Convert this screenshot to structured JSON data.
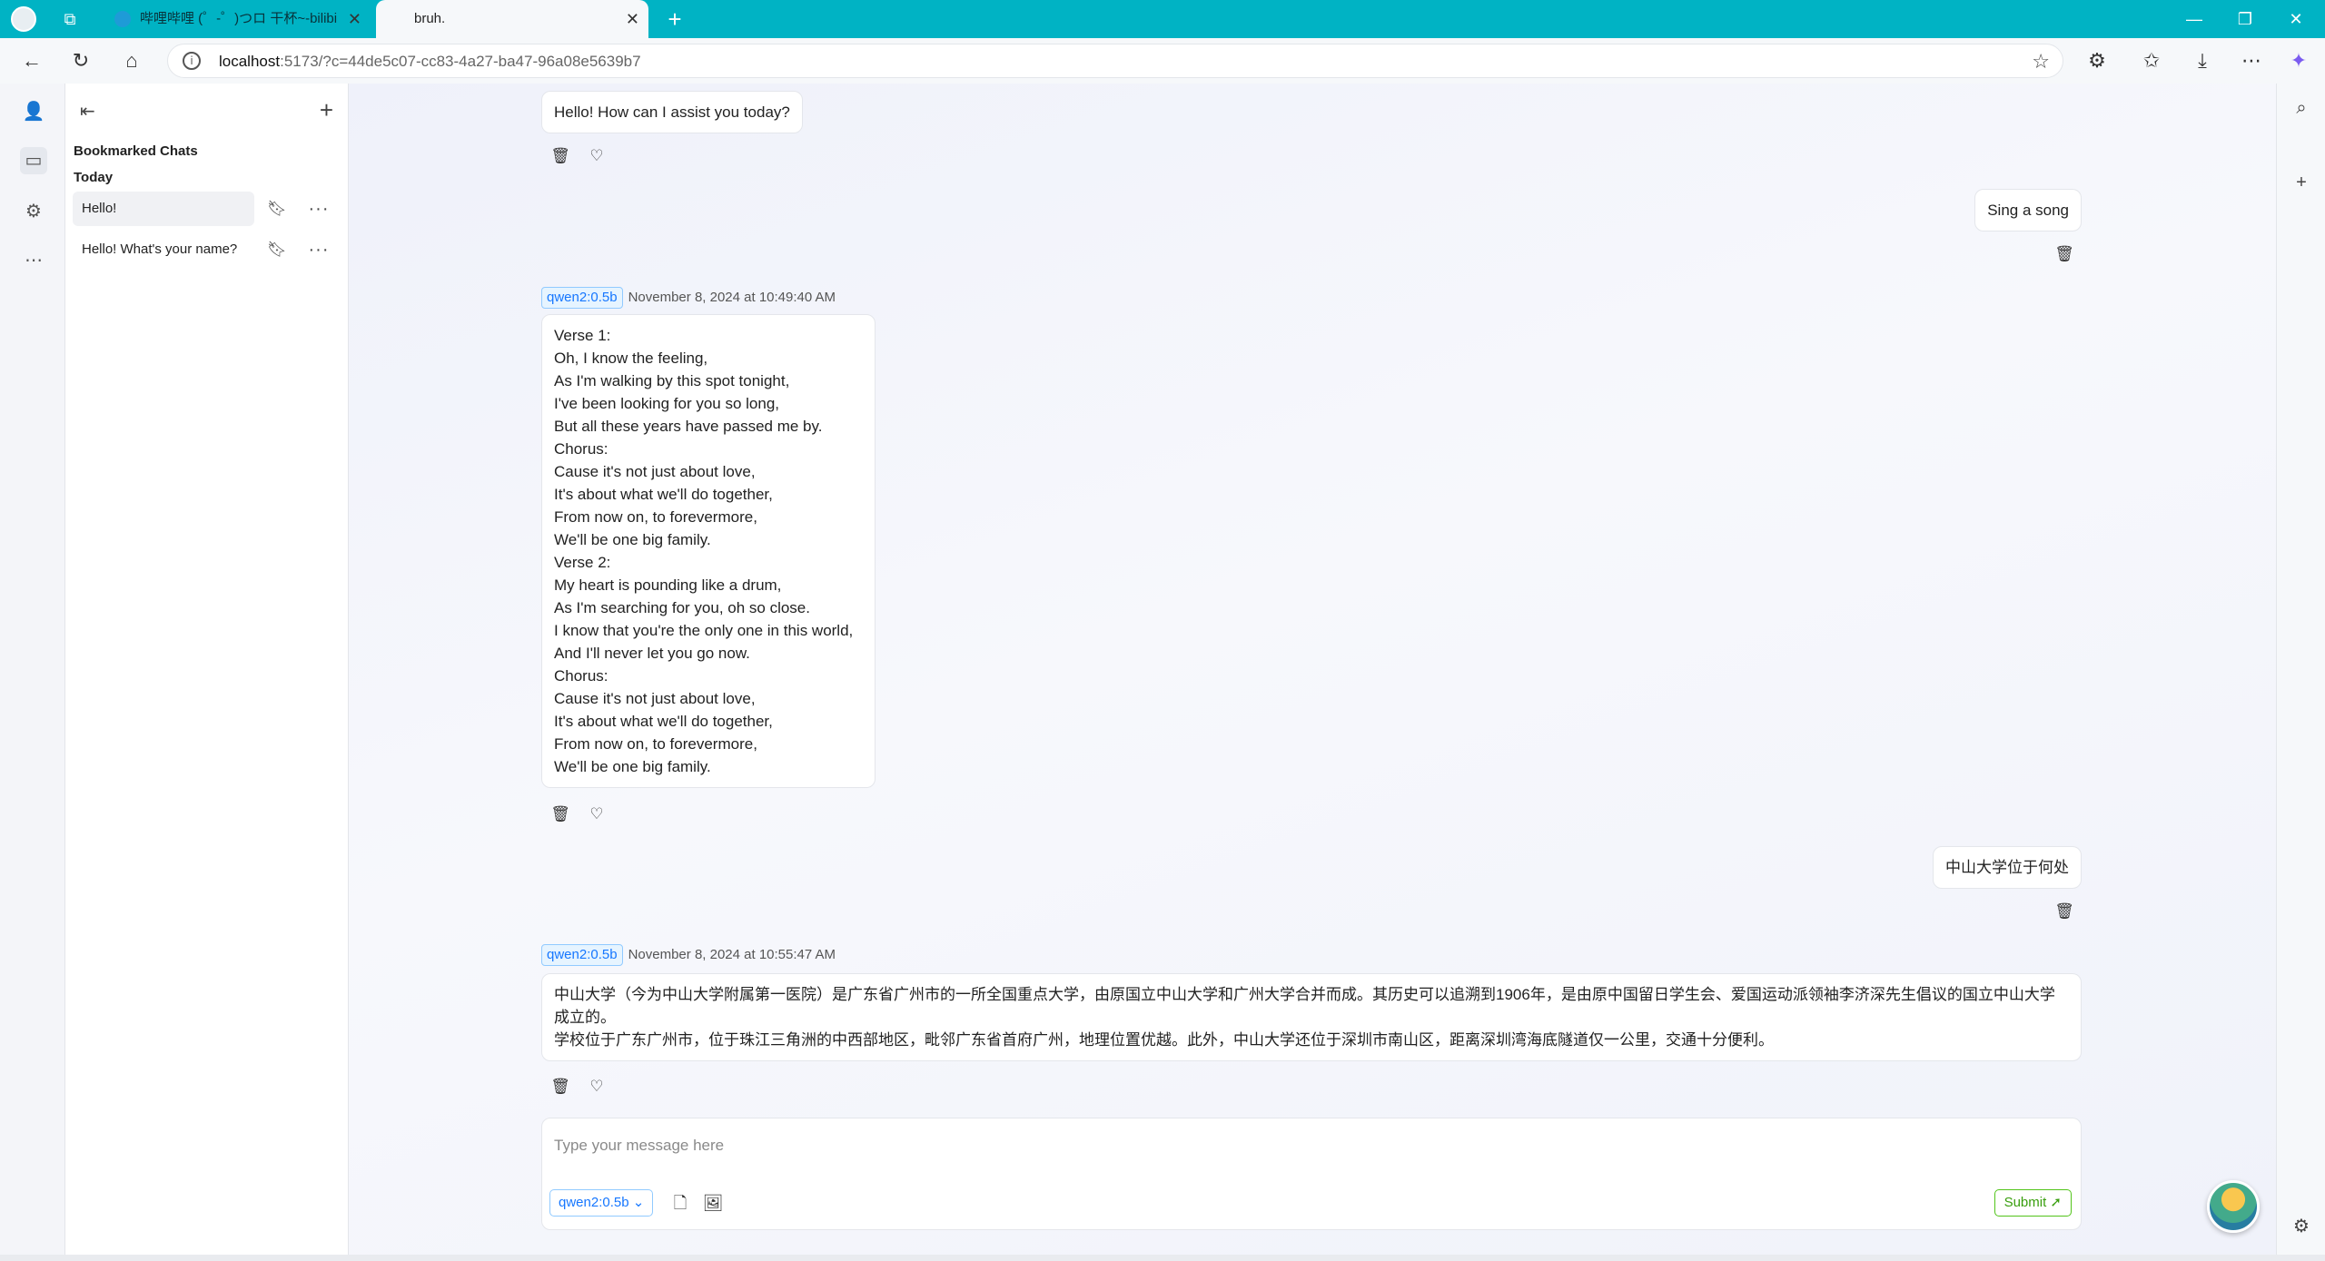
{
  "browser": {
    "tabs": [
      {
        "title": "哔哩哔哩 (゜-゜)つロ 干杯~-bilibi",
        "active": false
      },
      {
        "title": "bruh.",
        "active": true
      }
    ],
    "url_host": "localhost",
    "url_rest": ":5173/?c=44de5c07-cc83-4a27-ba47-96a08e5639b7"
  },
  "sidebar": {
    "heading": "Bookmarked Chats",
    "group_label": "Today",
    "chats": [
      {
        "title": "Hello!",
        "selected": true
      },
      {
        "title": "Hello! What's your name?",
        "selected": false
      }
    ]
  },
  "messages": {
    "greeting": "Hello! How can I assist you today?",
    "user_song": "Sing a song",
    "song_model": "qwen2:0.5b",
    "song_time": "November 8, 2024 at 10:49:40 AM",
    "song_lines": [
      "Verse 1:",
      "Oh, I know the feeling,",
      "As I'm walking by this spot tonight,",
      "I've been looking for you so long,",
      "But all these years have passed me by.",
      "Chorus:",
      "Cause it's not just about love,",
      "It's about what we'll do together,",
      "From now on, to forevermore,",
      "We'll be one big family.",
      "Verse 2:",
      "My heart is pounding like a drum,",
      "As I'm searching for you, oh so close.",
      "I know that you're the only one in this world,",
      "And I'll never let you go now.",
      "Chorus:",
      "Cause it's not just about love,",
      "It's about what we'll do together,",
      "From now on, to forevermore,",
      "We'll be one big family."
    ],
    "user_question": "中山大学位于何处",
    "answer_model": "qwen2:0.5b",
    "answer_time": "November 8, 2024 at 10:55:47 AM",
    "answer_p1": "中山大学（今为中山大学附属第一医院）是广东省广州市的一所全国重点大学，由原国立中山大学和广州大学合并而成。其历史可以追溯到1906年，是由原中国留日学生会、爱国运动派领袖李济深先生倡议的国立中山大学成立的。",
    "answer_p2": "学校位于广东广州市，位于珠江三角洲的中西部地区，毗邻广东省首府广州，地理位置优越。此外，中山大学还位于深圳市南山区，距离深圳湾海底隧道仅一公里，交通十分便利。"
  },
  "composer": {
    "placeholder": "Type your message here",
    "model": "qwen2:0.5b",
    "submit_label": "Submit"
  },
  "colors": {
    "tabbar": "#00b3c4",
    "model_tag": "#1677ff",
    "submit": "#389e0d"
  }
}
